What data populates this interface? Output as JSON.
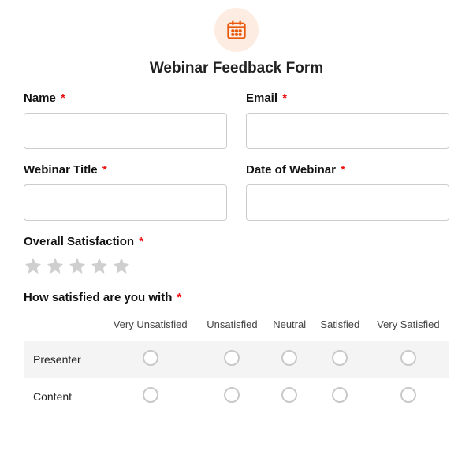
{
  "header": {
    "title": "Webinar Feedback Form"
  },
  "fields": {
    "name": {
      "label": "Name",
      "required": "*"
    },
    "email": {
      "label": "Email",
      "required": "*"
    },
    "webinarTitle": {
      "label": "Webinar Title",
      "required": "*"
    },
    "webinarDate": {
      "label": "Date of Webinar",
      "required": "*"
    },
    "overall": {
      "label": "Overall Satisfaction",
      "required": "*"
    },
    "matrix": {
      "label": "How satisfied are you with",
      "required": "*"
    }
  },
  "matrix": {
    "columns": [
      "Very Unsatisfied",
      "Unsatisfied",
      "Neutral",
      "Satisfied",
      "Very Satisfied"
    ],
    "rows": [
      "Presenter",
      "Content"
    ]
  }
}
